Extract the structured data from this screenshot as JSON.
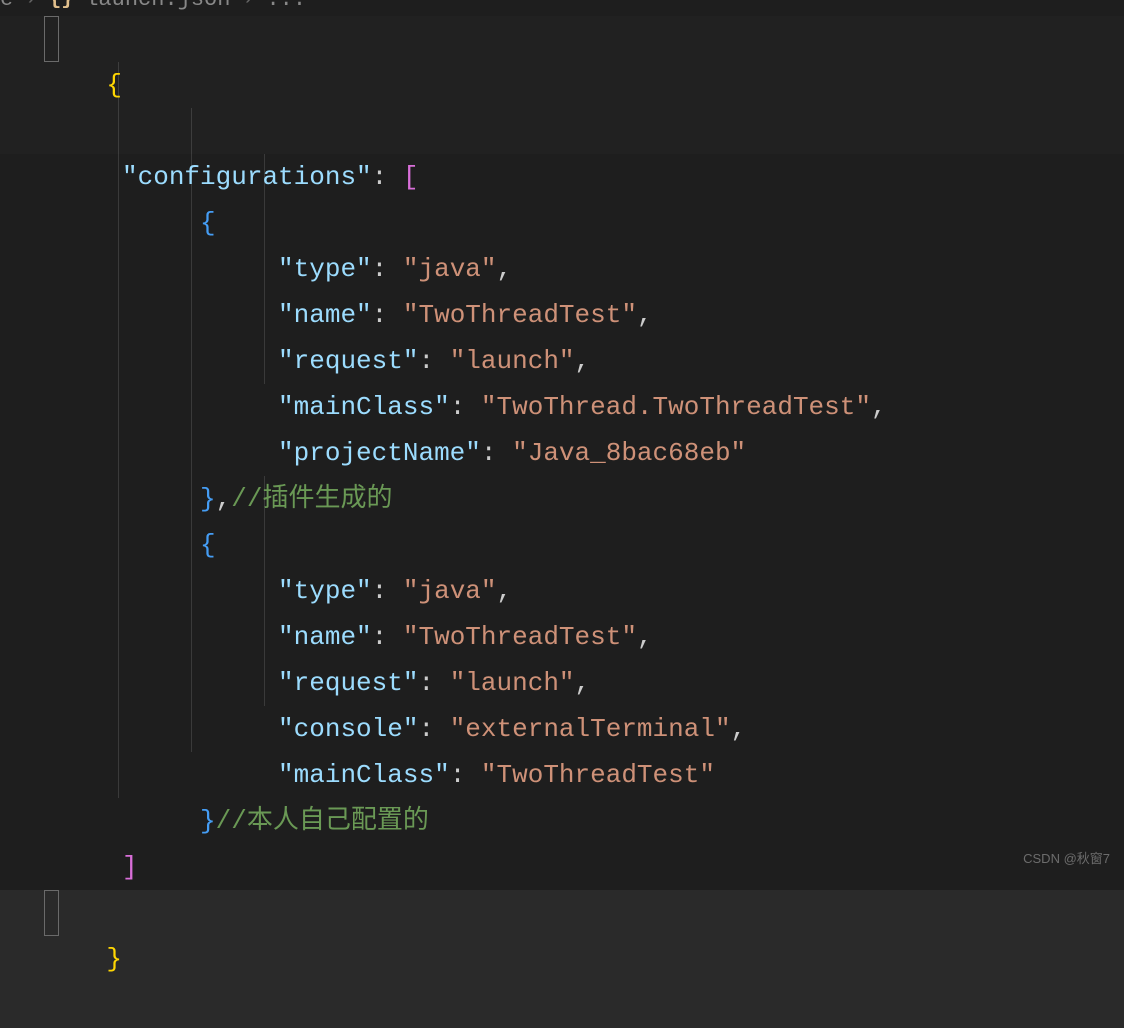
{
  "breadcrumb": {
    "prefix": "e",
    "filename": "launch.json",
    "trailing": "..."
  },
  "code": {
    "key_configurations": "\"configurations\"",
    "obj1": {
      "type_k": "\"type\"",
      "type_v": "\"java\"",
      "name_k": "\"name\"",
      "name_v": "\"TwoThreadTest\"",
      "request_k": "\"request\"",
      "request_v": "\"launch\"",
      "mainClass_k": "\"mainClass\"",
      "mainClass_v": "\"TwoThread.TwoThreadTest\"",
      "projectName_k": "\"projectName\"",
      "projectName_v": "\"Java_8bac68eb\"",
      "comment": "//插件生成的"
    },
    "obj2": {
      "type_k": "\"type\"",
      "type_v": "\"java\"",
      "name_k": "\"name\"",
      "name_v": "\"TwoThreadTest\"",
      "request_k": "\"request\"",
      "request_v": "\"launch\"",
      "console_k": "\"console\"",
      "console_v": "\"externalTerminal\"",
      "mainClass_k": "\"mainClass\"",
      "mainClass_v": "\"TwoThreadTest\"",
      "comment": "//本人自己配置的"
    }
  },
  "watermark": "CSDN @秋窗7"
}
